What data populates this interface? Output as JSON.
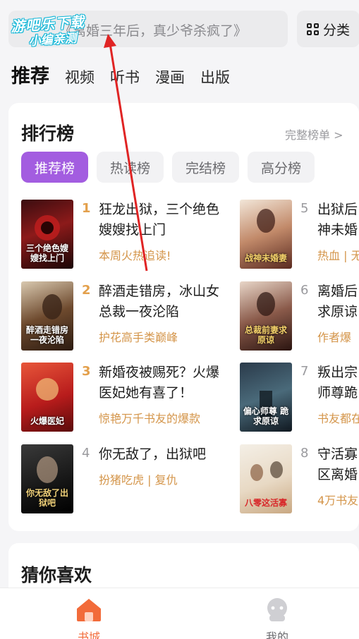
{
  "watermark": {
    "line1": "游吧乐下载",
    "line2": "小编亲测"
  },
  "search": {
    "placeholder": "《离婚三年后，真少爷杀疯了》"
  },
  "category_button": {
    "label": "分类",
    "icon": "grid-icon"
  },
  "top_tabs": [
    "推荐",
    "视频",
    "听书",
    "漫画",
    "出版"
  ],
  "ranking": {
    "title": "排行榜",
    "more": "完整榜单 >",
    "chips": [
      "推荐榜",
      "热读榜",
      "完结榜",
      "高分榜"
    ],
    "books": [
      {
        "rank": "1",
        "title": "狂龙出狱，三个绝色嫂嫂找上门",
        "tag": "本周火热追读!",
        "cover_text": "三个绝色嫂嫂找上门"
      },
      {
        "rank": "2",
        "title": "醉酒走错房，冰山女总裁一夜沦陷",
        "tag": "护花高手类巅峰",
        "cover_text": "醉酒走错房 一夜沦陷"
      },
      {
        "rank": "3",
        "title": "新婚夜被赐死？火爆医妃她有喜了！",
        "tag": "惊艳万千书友的爆款",
        "cover_text": "火爆医妃"
      },
      {
        "rank": "4",
        "title": "你无敌了，出狱吧",
        "tag": "扮猪吃虎 | 复仇",
        "cover_text": "你无敌了出狱吧"
      },
      {
        "rank": "5",
        "title": "出狱后神未婚",
        "tag": "热血 | 无",
        "cover_text": "战神未婚妻"
      },
      {
        "rank": "6",
        "title": "离婚后求原谅",
        "tag": "作者爆",
        "cover_text": "总裁前妻求原谅"
      },
      {
        "rank": "7",
        "title": "叛出宗师尊跪",
        "tag": "书友都在",
        "cover_text": "偏心师尊 跪求原谅"
      },
      {
        "rank": "8",
        "title": "守活寡区离婚",
        "tag": "4万书友",
        "cover_text": "八零这活寡"
      }
    ]
  },
  "guess": {
    "title": "猜你喜欢"
  },
  "bottom_nav": [
    {
      "label": "书城",
      "icon": "home-icon",
      "active": true
    },
    {
      "label": "我的",
      "icon": "profile-icon",
      "active": false
    }
  ],
  "colors": {
    "accent": "#a35de0",
    "tag": "#d4954a",
    "nav_active": "#f26b3a",
    "arrow": "#e02424",
    "rank_top": "#e3a04c"
  }
}
